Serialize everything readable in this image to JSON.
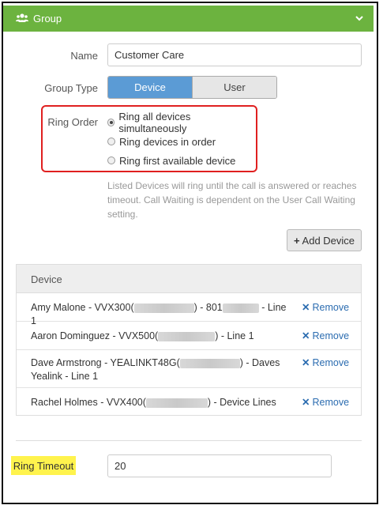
{
  "header": {
    "title": "Group",
    "icon": "users-icon",
    "collapse_icon": "chevron-down-icon",
    "color": "#6cb33f"
  },
  "form": {
    "name_label": "Name",
    "name_value": "Customer Care",
    "group_type_label": "Group Type",
    "group_type_options": [
      "Device",
      "User"
    ],
    "group_type_selected": "Device",
    "ring_order_label": "Ring Order",
    "ring_order_options": [
      "Ring all devices simultaneously",
      "Ring devices in order",
      "Ring first available device"
    ],
    "ring_order_selected": "Ring all devices simultaneously",
    "help_text": "Listed Devices will ring until the call is answered or reaches timeout. Call Waiting is dependent on the User Call Waiting setting.",
    "add_device_label": "Add Device"
  },
  "devices": {
    "header": "Device",
    "remove_label": "Remove",
    "rows": [
      {
        "name_a": "Amy Malone - VVX300(",
        "name_b": ") - 801",
        "name_c": " - Line 1"
      },
      {
        "name_a": "Aaron Dominguez - VVX500(",
        "name_b": ") - Line 1",
        "name_c": ""
      },
      {
        "name_a": "Dave Armstrong - YEALINKT48G(",
        "name_b": ") - Daves Yealink - Line 1",
        "name_c": ""
      },
      {
        "name_a": "Rachel Holmes - VVX400(",
        "name_b": ") - Device Lines",
        "name_c": ""
      }
    ]
  },
  "ring_timeout": {
    "label": "Ring Timeout",
    "value": "20"
  }
}
